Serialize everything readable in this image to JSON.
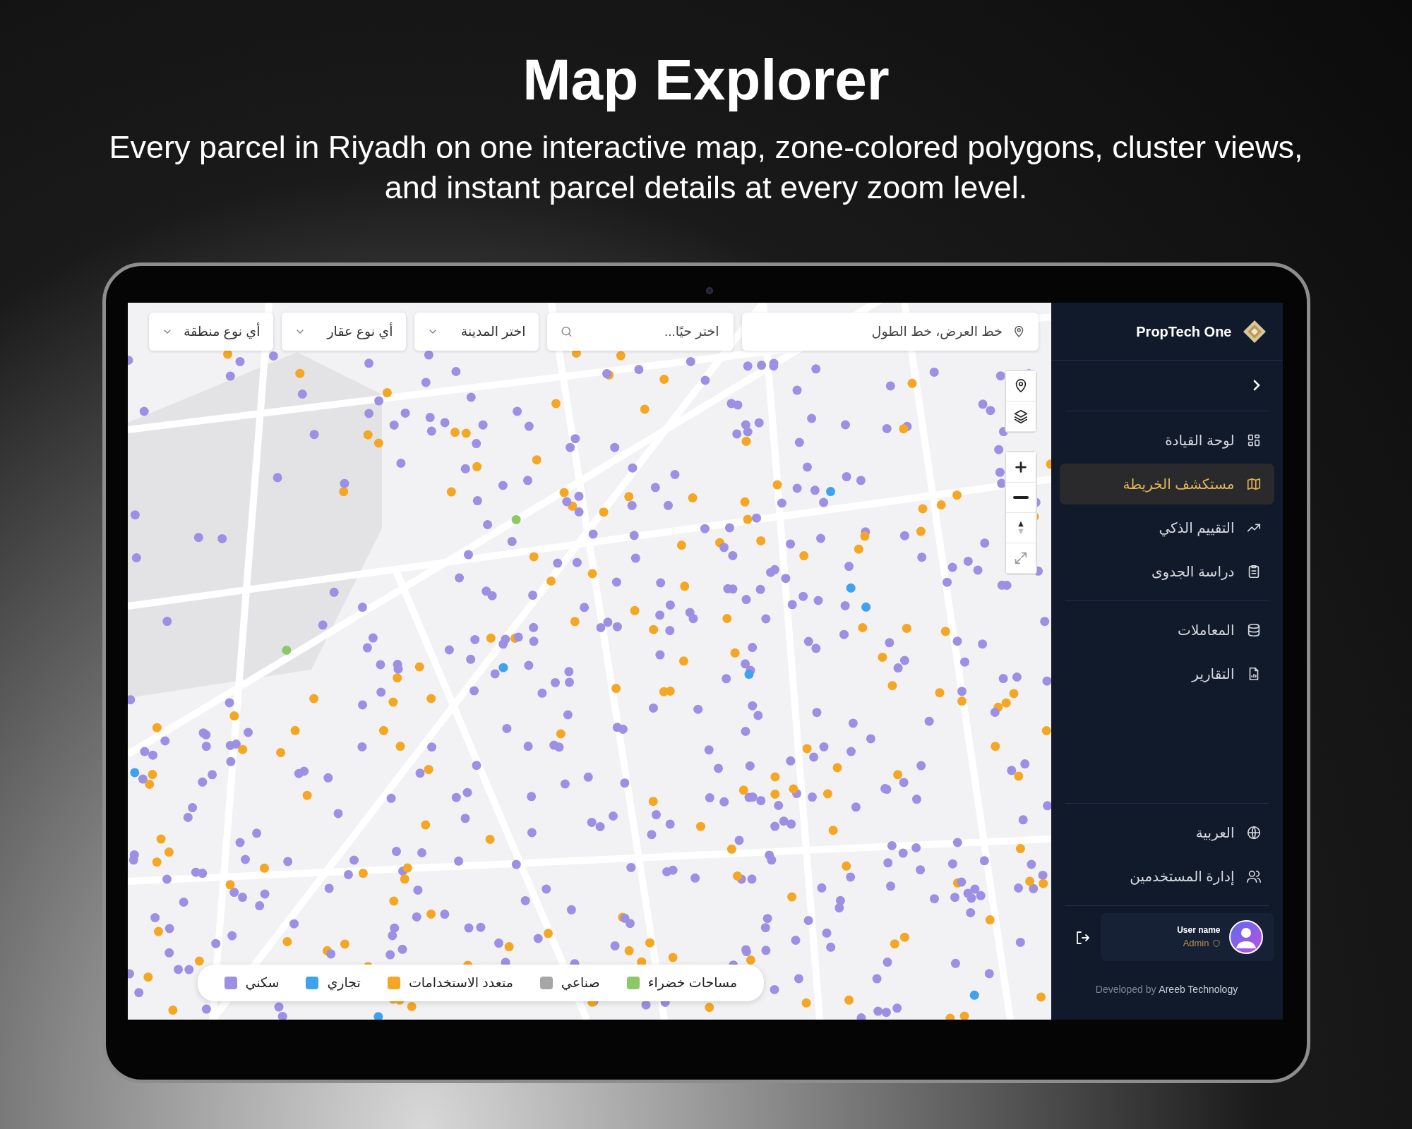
{
  "page": {
    "title": "Map Explorer",
    "subtitle": "Every parcel in Riyadh on one interactive map, zone-colored polygons, cluster views, and instant parcel details at every zoom level."
  },
  "filters": [
    {
      "kind": "coords",
      "placeholder": "خط العرض، خط الطول"
    },
    {
      "kind": "search",
      "placeholder": "اختر حيًا..."
    },
    {
      "kind": "select",
      "value": "اختر المدينة"
    },
    {
      "kind": "select",
      "value": "أي نوع عقار"
    },
    {
      "kind": "select",
      "value": "أي نوع منطقة"
    }
  ],
  "map_controls": [
    {
      "kind": "locate"
    },
    {
      "kind": "layers"
    },
    {
      "kind": "zoom-in"
    },
    {
      "kind": "zoom-out"
    },
    {
      "kind": "compass"
    },
    {
      "kind": "expand"
    }
  ],
  "legend": [
    {
      "label": "مساحات خضراء",
      "color": "#8cc866"
    },
    {
      "label": "صناعي",
      "color": "#a6a6a6"
    },
    {
      "label": "متعدد الاستخدامات",
      "color": "#f5a623"
    },
    {
      "label": "تجاري",
      "color": "#3ea2ee"
    },
    {
      "label": "سكني",
      "color": "#9d8fe3"
    }
  ],
  "sidebar": {
    "brand": "PropTech One",
    "nav_groups": [
      [
        {
          "label": "لوحة القيادة",
          "kind": "grid",
          "selected": false
        },
        {
          "label": "مستكشف الخريطة",
          "kind": "map",
          "selected": true
        },
        {
          "label": "التقييم الذكي",
          "kind": "trend",
          "selected": false
        },
        {
          "label": "دراسة الجدوى",
          "kind": "clipboard",
          "selected": false
        }
      ],
      [
        {
          "label": "المعاملات",
          "kind": "database",
          "selected": false
        },
        {
          "label": "التقارير",
          "kind": "report",
          "selected": false
        }
      ]
    ],
    "footer_items": [
      {
        "label": "العربية",
        "kind": "globe"
      },
      {
        "label": "إدارة المستخدمين",
        "kind": "users"
      }
    ],
    "user": {
      "name": "User name",
      "role": "Admin"
    },
    "credit": "Developed by **Areeb Technology**"
  }
}
